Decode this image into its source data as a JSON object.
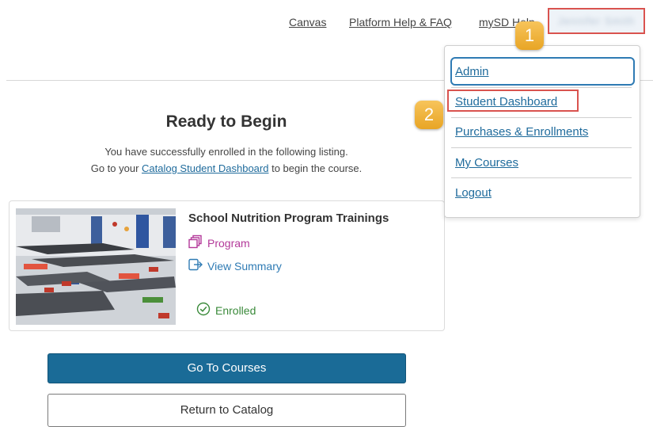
{
  "topnav": {
    "links": [
      "Canvas",
      "Platform Help & FAQ",
      "mySD Help"
    ],
    "user_name": "Jennifer Smith"
  },
  "markers": [
    "1",
    "2"
  ],
  "main": {
    "heading": "Ready to Begin",
    "line1": "You have successfully enrolled in the following listing.",
    "line2_prefix": "Go to your ",
    "line2_link": "Catalog Student Dashboard",
    "line2_suffix": " to begin the course."
  },
  "card": {
    "title": "School Nutrition Program Trainings",
    "type_label": "Program",
    "summary_label": "View Summary",
    "status_label": "Enrolled"
  },
  "menu": {
    "items": [
      "Admin",
      "Student Dashboard",
      "Purchases & Enrollments",
      "My Courses",
      "Logout"
    ]
  },
  "buttons": {
    "go_to_courses": "Go To Courses",
    "return_to_catalog": "Return to Catalog"
  },
  "colors": {
    "primary": "#1a6b97",
    "link": "#1f6b9c",
    "program": "#b3399a",
    "view_summary": "#2f7bb4",
    "enrolled": "#3a8a3a",
    "highlight_red": "#d9534f",
    "marker": "#f0b43c"
  }
}
